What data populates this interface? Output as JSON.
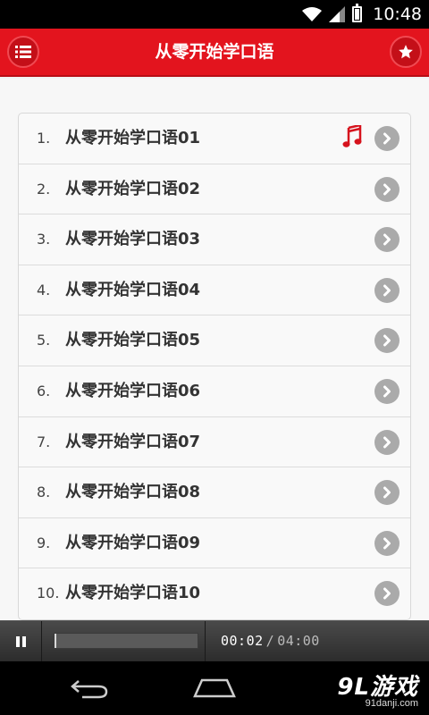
{
  "status_bar": {
    "time": "10:48",
    "icons": [
      "wifi-icon",
      "signal-icon",
      "battery-icon"
    ]
  },
  "header": {
    "title": "从零开始学口语",
    "left_icon": "list-menu-icon",
    "right_icon": "star-icon",
    "colors": {
      "background": "#e3141e",
      "button": "#c40f18"
    }
  },
  "lessons": [
    {
      "number": "1.",
      "title": "从零开始学口语01",
      "playing": true
    },
    {
      "number": "2.",
      "title": "从零开始学口语02",
      "playing": false
    },
    {
      "number": "3.",
      "title": "从零开始学口语03",
      "playing": false
    },
    {
      "number": "4.",
      "title": "从零开始学口语04",
      "playing": false
    },
    {
      "number": "5.",
      "title": "从零开始学口语05",
      "playing": false
    },
    {
      "number": "6.",
      "title": "从零开始学口语06",
      "playing": false
    },
    {
      "number": "7.",
      "title": "从零开始学口语07",
      "playing": false
    },
    {
      "number": "8.",
      "title": "从零开始学口语08",
      "playing": false
    },
    {
      "number": "9.",
      "title": "从零开始学口语09",
      "playing": false
    },
    {
      "number": "10.",
      "title": "从零开始学口语10",
      "playing": false
    }
  ],
  "player": {
    "current_time": "00:02",
    "separator": "/",
    "total_time": "04:00",
    "progress": 0.01,
    "pause_icon": "pause-icon"
  },
  "nav_bar": {
    "back_icon": "back-icon",
    "home_icon": "home-icon"
  },
  "watermark": {
    "main": "9L游戏",
    "sub": "91danji.com"
  }
}
